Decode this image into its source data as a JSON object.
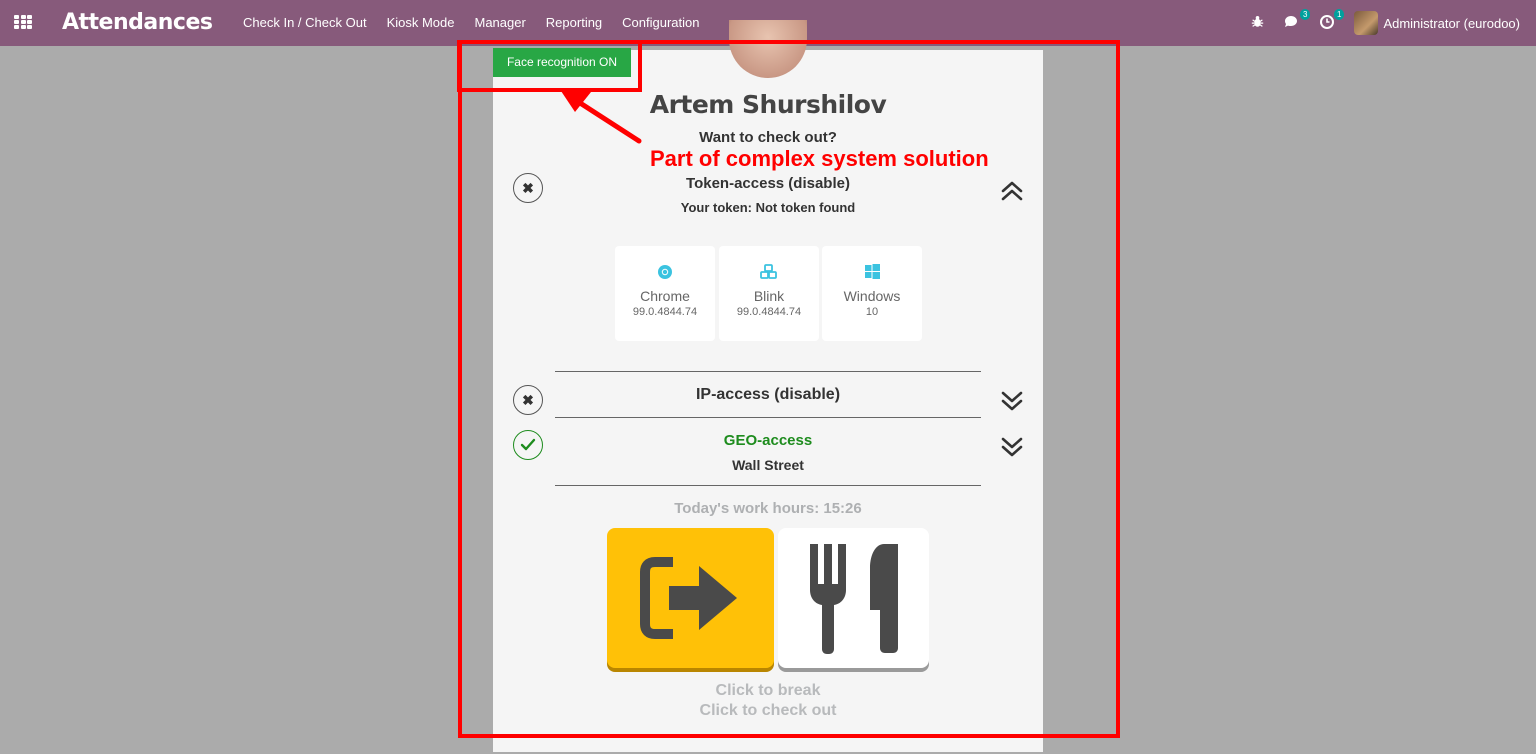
{
  "topbar": {
    "app_title": "Attendances",
    "menu": [
      "Check In / Check Out",
      "Kiosk Mode",
      "Manager",
      "Reporting",
      "Configuration"
    ],
    "messages_count": "3",
    "activities_count": "1",
    "user": "Administrator (eurodoo)"
  },
  "kiosk": {
    "face_badge": "Face recognition ON",
    "employee_name": "Artem Shurshilov",
    "prompt": "Want to check out?",
    "token_title": "Token-access (disable)",
    "token_info": "Your token: Not token found",
    "tiles": [
      {
        "name": "Chrome",
        "version": "99.0.4844.74",
        "icon": "chrome-icon"
      },
      {
        "name": "Blink",
        "version": "99.0.4844.74",
        "icon": "blink-icon"
      },
      {
        "name": "Windows",
        "version": "10",
        "icon": "windows-icon"
      }
    ],
    "ip_title": "IP-access (disable)",
    "geo_title": "GEO-access",
    "geo_location": "Wall Street",
    "hours": "Today's work hours: 15:26",
    "click_break": "Click to break",
    "click_checkout": "Click to check out"
  },
  "annotation": {
    "text": "Part of complex system solution",
    "color": "#ff0000"
  },
  "colors": {
    "topbar": "#875a7b",
    "face_badge": "#28a745",
    "checkout_button": "#ffc107",
    "geo_ok": "#1e8c1e"
  }
}
